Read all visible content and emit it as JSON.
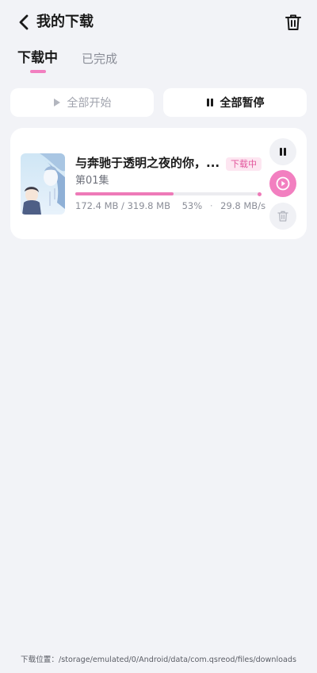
{
  "header": {
    "title": "我的下载",
    "back_icon": "chevron-left-icon",
    "trash_icon": "trash-icon"
  },
  "tabs": [
    {
      "label": "下载中",
      "active": true
    },
    {
      "label": "已完成",
      "active": false
    }
  ],
  "actions": {
    "start_all_label": "全部开始",
    "pause_all_label": "全部暂停"
  },
  "downloads": [
    {
      "title": "与奔驰于透明之夜的你，...",
      "status": "下载中",
      "episode": "第01集",
      "progress": 0.53,
      "downloaded": "172.4 MB",
      "total": "319.8 MB",
      "percent": "53%",
      "speed": "29.8 MB/s"
    }
  ],
  "footer": {
    "path": "下载位置：/storage/emulated/0/Android/data/com.qsreod/files/downloads"
  },
  "colors": {
    "accent": "#f27fc0",
    "background": "#f2f3f7",
    "card": "#ffffff"
  }
}
